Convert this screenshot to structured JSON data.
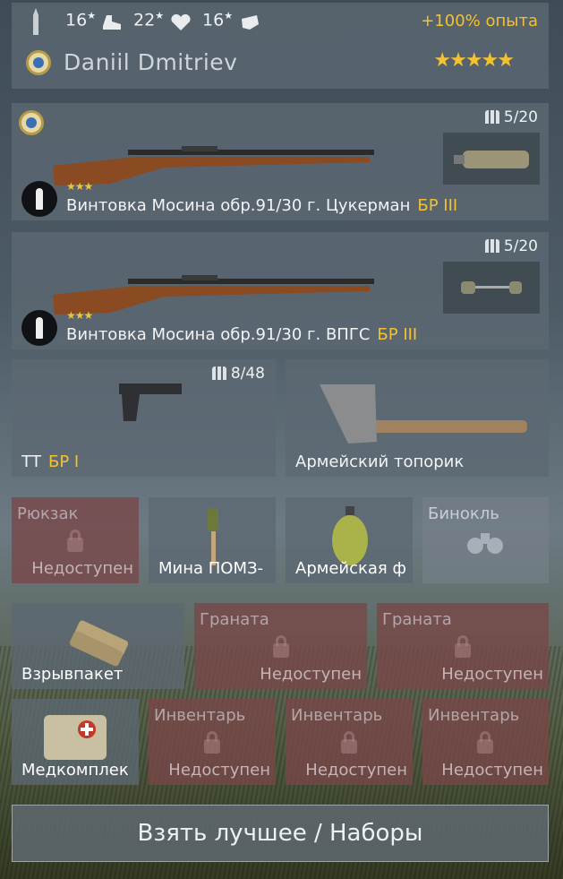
{
  "header": {
    "stats": [
      {
        "value": "16",
        "icon": "bullet-icon"
      },
      {
        "value": "22",
        "icon": "boot-icon"
      },
      {
        "value": "16",
        "icon": "heart-icon"
      }
    ],
    "extra_icon": "fist-icon",
    "xp_bonus": "+100% опыта",
    "player_name": "Daniil Dmitriev",
    "rank_stars": "★★★★★"
  },
  "weapons": [
    {
      "name": "Винтовка Мосина обр.91/30 г. Цукерман",
      "br": "БР III",
      "ammo": "5/20",
      "stars": "★★★"
    },
    {
      "name": "Винтовка Мосина обр.91/30 г. ВПГС",
      "br": "БР III",
      "ammo": "5/20",
      "stars": "★★★"
    }
  ],
  "pistol": {
    "name": "ТТ",
    "br": "БР I",
    "ammo": "8/48"
  },
  "melee": {
    "name": "Армейский топорик"
  },
  "row1": [
    {
      "label": "Рюкзак",
      "status": "Недоступен"
    },
    {
      "label": "Мина ПОМЗ-"
    },
    {
      "label": "Армейская ф"
    },
    {
      "label": "Бинокль"
    }
  ],
  "row2": [
    {
      "label": "Взрывпакет"
    },
    {
      "label": "Граната",
      "status": "Недоступен"
    },
    {
      "label": "Граната",
      "status": "Недоступен"
    }
  ],
  "row3": [
    {
      "label": "Медкомплек"
    },
    {
      "label": "Инвентарь",
      "status": "Недоступен"
    },
    {
      "label": "Инвентарь",
      "status": "Недоступен"
    },
    {
      "label": "Инвентарь",
      "status": "Недоступен"
    }
  ],
  "bottom_button": "Взять лучшее / Наборы",
  "colors": {
    "accent_gold": "#f3c233",
    "locked_red": "#784648"
  }
}
